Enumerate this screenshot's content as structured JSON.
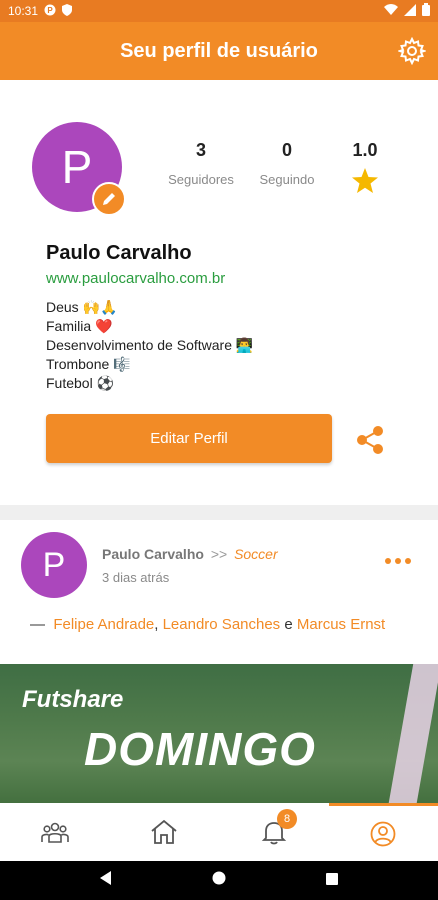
{
  "status_bar": {
    "time": "10:31",
    "left_icons": [
      "p-circle-icon",
      "shield-icon"
    ],
    "right_icons": [
      "wifi-icon",
      "signal-icon",
      "battery-icon"
    ]
  },
  "header": {
    "title": "Seu perfil de usuário",
    "settings_icon": "gear-icon"
  },
  "profile": {
    "avatar_letter": "P",
    "avatar_color": "#ab47bc",
    "name": "Paulo Carvalho",
    "website": "www.paulocarvalho.com.br",
    "bio": [
      "Deus 🙌🙏",
      "Familia ❤️",
      "Desenvolvimento de Software 👨‍💻",
      "Trombone 🎼",
      "Futebol ⚽"
    ],
    "stats": {
      "followers_value": "3",
      "followers_label": "Seguidores",
      "following_value": "0",
      "following_label": "Seguindo",
      "rating_value": "1.0",
      "rating_icon": "star-icon"
    },
    "edit_button_label": "Editar Perfil",
    "share_icon": "share-icon"
  },
  "post": {
    "avatar_letter": "P",
    "author": "Paulo Carvalho",
    "arrow": ">>",
    "group": "Soccer",
    "time": "3 dias atrás",
    "tag_prefix": "—",
    "tagged": [
      "Felipe Andrade",
      "Leandro Sanches",
      "Marcus Ernst"
    ],
    "tag_separator": ",",
    "tag_conjunction": "e",
    "image": {
      "brand": "Futshare",
      "headline": "DOMINGO"
    }
  },
  "bottom_nav": {
    "items": [
      {
        "icon": "group-icon",
        "active": false
      },
      {
        "icon": "home-icon",
        "active": false
      },
      {
        "icon": "bell-icon",
        "active": false,
        "badge": "8"
      },
      {
        "icon": "user-circle-icon",
        "active": true
      }
    ]
  },
  "colors": {
    "accent": "#f28b26",
    "link_green": "#2a9d3f"
  }
}
